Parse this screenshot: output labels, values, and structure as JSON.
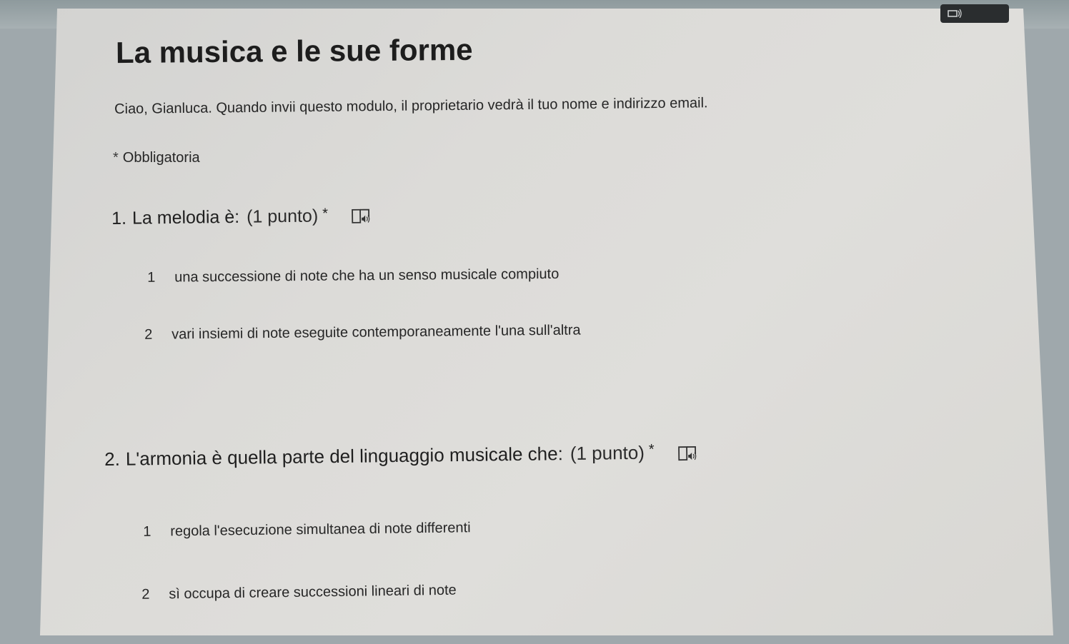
{
  "form": {
    "title": "La musica e le sue forme",
    "greeting": "Ciao, Gianluca. Quando invii questo modulo, il proprietario vedrà il tuo nome e indirizzo email.",
    "required_star": "*",
    "required_label": "Obbligatoria"
  },
  "questions": [
    {
      "number": "1.",
      "text": "La melodia è:",
      "points": "(1 punto)",
      "required_star": "*",
      "icon": "immersive-reader-icon",
      "choices": [
        {
          "key": "1",
          "label": "una successione di note che ha un senso musicale compiuto"
        },
        {
          "key": "2",
          "label": "vari insiemi di note eseguite contemporaneamente l'una sull'altra"
        }
      ]
    },
    {
      "number": "2.",
      "text": "L'armonia è quella parte del linguaggio musicale che:",
      "points": "(1 punto)",
      "required_star": "*",
      "icon": "immersive-reader-icon",
      "choices": [
        {
          "key": "1",
          "label": "regola l'esecuzione simultanea di note differenti"
        },
        {
          "key": "2",
          "label": "sì occupa di creare successioni lineari di note"
        }
      ]
    }
  ]
}
